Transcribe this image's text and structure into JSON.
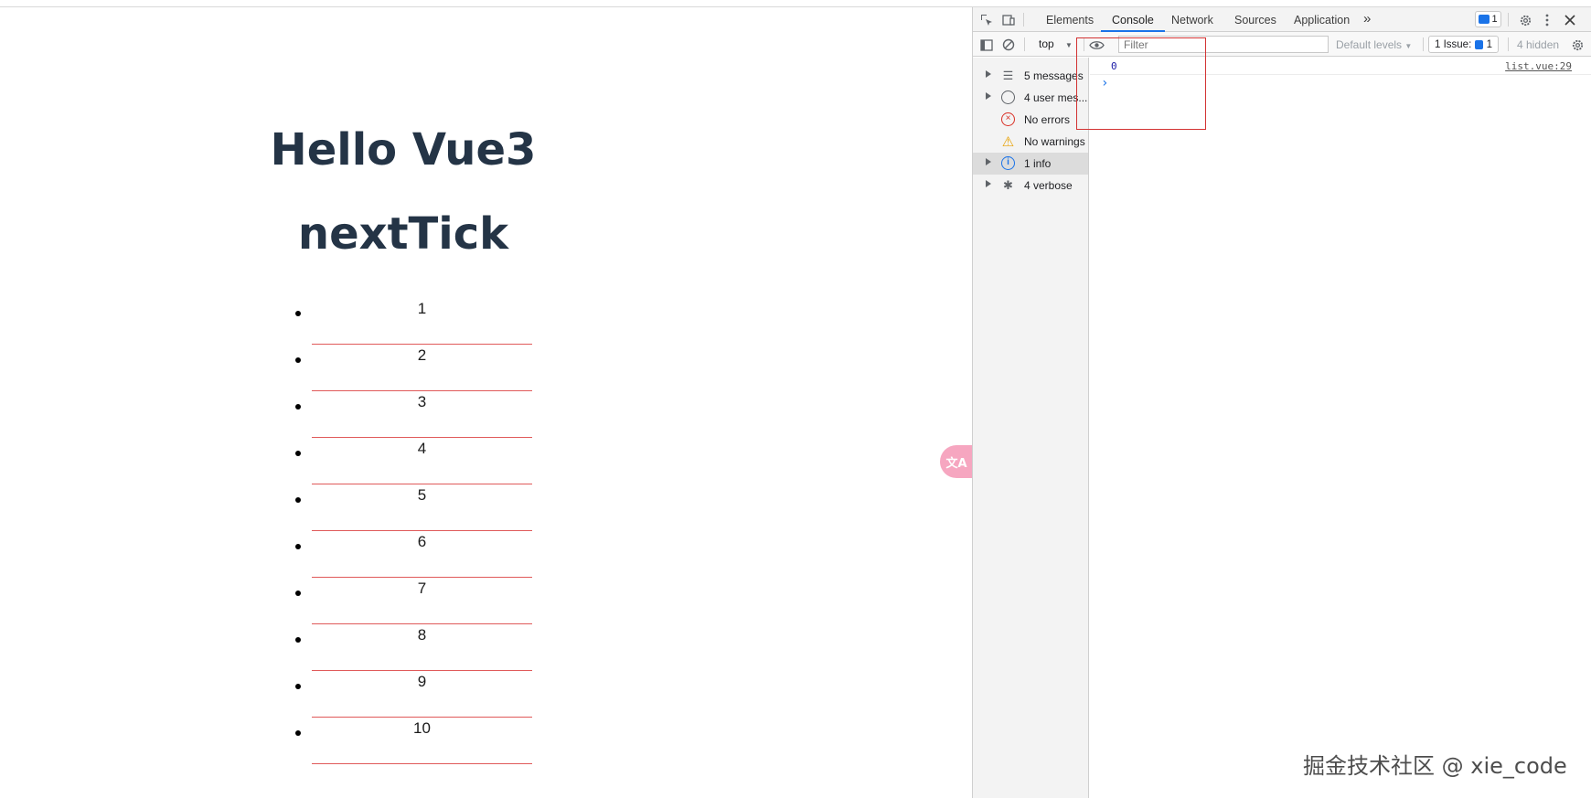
{
  "app": {
    "title_line1": "Hello Vue3",
    "title_line2": "nextTick",
    "items": [
      "1",
      "2",
      "3",
      "4",
      "5",
      "6",
      "7",
      "8",
      "9",
      "10"
    ],
    "translate_icon": "translate-icon"
  },
  "devtools": {
    "tabs": [
      "Elements",
      "Console",
      "Network",
      "Sources",
      "Application"
    ],
    "active_tab": "Console",
    "more_tabs": "»",
    "messages_badge": "1",
    "toolbar": {
      "context": "top",
      "filter_placeholder": "Filter",
      "levels": "Default levels",
      "issues_label": "1 Issue:",
      "issues_count": "1",
      "hidden": "4 hidden"
    },
    "sidebar": [
      {
        "label": "5 messages",
        "icon": "list-icon",
        "expandable": true
      },
      {
        "label": "4 user mes...",
        "icon": "user-icon",
        "expandable": true
      },
      {
        "label": "No errors",
        "icon": "error-icon",
        "expandable": false
      },
      {
        "label": "No warnings",
        "icon": "warning-icon",
        "expandable": false
      },
      {
        "label": "1 info",
        "icon": "info-icon",
        "expandable": true,
        "selected": true
      },
      {
        "label": "4 verbose",
        "icon": "bug-icon",
        "expandable": true
      }
    ],
    "console": {
      "log_value": "0",
      "log_source": "list.vue:29",
      "prompt": "›"
    }
  },
  "watermark": "掘金技术社区 @ xie_code",
  "colors": {
    "title": "#243446",
    "item_divider": "#e05a5a",
    "highlight_box": "#d33333",
    "accent": "#1a73e8"
  }
}
